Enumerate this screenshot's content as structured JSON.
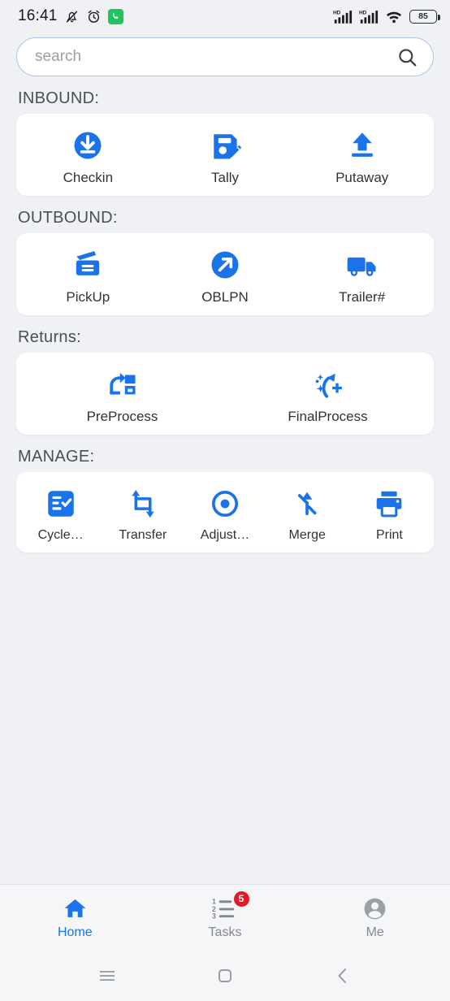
{
  "status_bar": {
    "time": "16:41",
    "battery_level": "85",
    "icons": [
      "silent-bell-icon",
      "alarm-icon",
      "phone-call-icon",
      "hd-signal-icon",
      "hd-signal-icon",
      "wifi-icon",
      "battery-icon"
    ],
    "network_label": "HD"
  },
  "search": {
    "value": "",
    "placeholder": "search",
    "icon": "search-icon"
  },
  "sections": [
    {
      "title": "INBOUND:",
      "columns": 3,
      "items": [
        {
          "label": "Checkin",
          "icon": "download-circle-icon"
        },
        {
          "label": "Tally",
          "icon": "save-edit-icon"
        },
        {
          "label": "Putaway",
          "icon": "upload-arrow-icon"
        }
      ]
    },
    {
      "title": "OUTBOUND:",
      "columns": 3,
      "items": [
        {
          "label": "PickUp",
          "icon": "open-box-icon"
        },
        {
          "label": "OBLPN",
          "icon": "arrow-up-right-circle-icon"
        },
        {
          "label": "Trailer#",
          "icon": "truck-icon"
        }
      ]
    },
    {
      "title": "Returns:",
      "columns": 2,
      "items": [
        {
          "label": "PreProcess",
          "icon": "reprocess-boxes-icon"
        },
        {
          "label": "FinalProcess",
          "icon": "sparkle-refresh-icon"
        }
      ]
    },
    {
      "title": "MANAGE:",
      "columns": 5,
      "items": [
        {
          "label": "Cycle…",
          "icon": "checklist-icon"
        },
        {
          "label": "Transfer",
          "icon": "transfer-crop-icon"
        },
        {
          "label": "Adjust…",
          "icon": "target-dot-icon"
        },
        {
          "label": "Merge",
          "icon": "merge-arrow-icon"
        },
        {
          "label": "Print",
          "icon": "printer-icon"
        }
      ]
    }
  ],
  "bottom_nav": {
    "items": [
      {
        "label": "Home",
        "icon": "home-icon",
        "active": true,
        "badge": ""
      },
      {
        "label": "Tasks",
        "icon": "numbered-list-icon",
        "active": false,
        "badge": "5"
      },
      {
        "label": "Me",
        "icon": "account-icon",
        "active": false,
        "badge": ""
      }
    ]
  },
  "android_nav": {
    "items": [
      {
        "name": "recents-button",
        "icon": "menu-lines-icon"
      },
      {
        "name": "home-button",
        "icon": "square-icon"
      },
      {
        "name": "back-button",
        "icon": "chevron-left-icon"
      }
    ]
  },
  "colors": {
    "accent": "#1a73e8",
    "badge": "#e01b24",
    "background": "#eff1f5",
    "card": "#ffffff",
    "muted_text": "#84888f"
  }
}
